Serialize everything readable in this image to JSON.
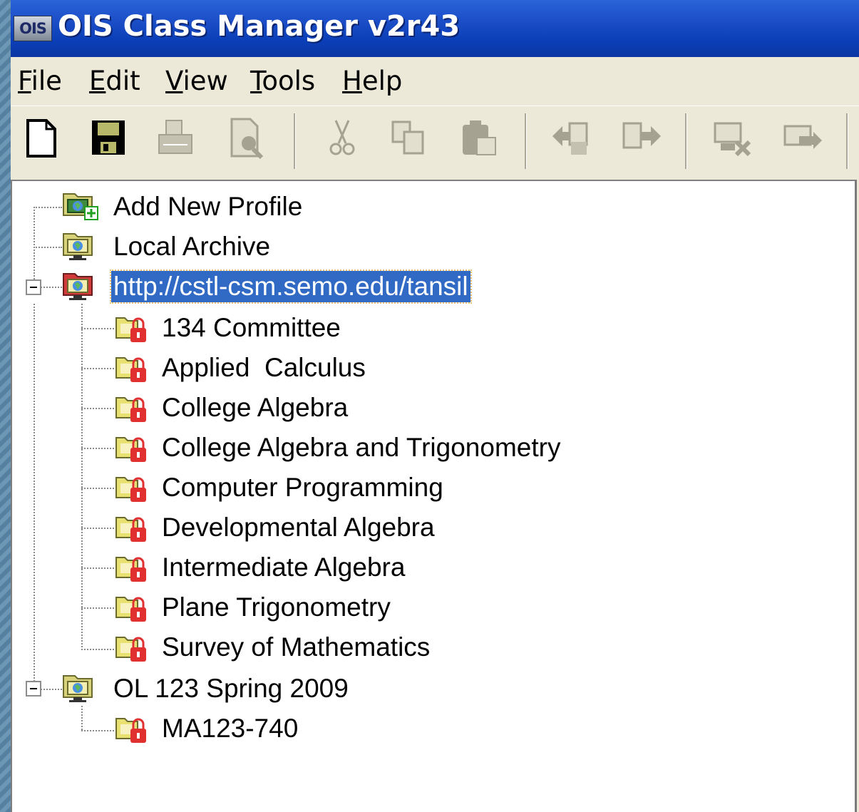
{
  "window": {
    "title": "OIS Class Manager v2r43",
    "icon_text": "OIS"
  },
  "menu": [
    {
      "label": "File",
      "underline": "F"
    },
    {
      "label": "Edit",
      "underline": "E"
    },
    {
      "label": "View",
      "underline": "V"
    },
    {
      "label": "Tools",
      "underline": "T"
    },
    {
      "label": "Help",
      "underline": "H"
    }
  ],
  "toolbar": {
    "buttons": [
      {
        "name": "new-icon",
        "enabled": true
      },
      {
        "name": "save-icon",
        "enabled": true
      },
      {
        "name": "print-icon",
        "enabled": false
      },
      {
        "name": "print-preview-icon",
        "enabled": false
      },
      {
        "name": "cut-icon",
        "enabled": false
      },
      {
        "name": "copy-icon",
        "enabled": false
      },
      {
        "name": "paste-icon",
        "enabled": false
      },
      {
        "name": "import-icon",
        "enabled": false
      },
      {
        "name": "export-icon",
        "enabled": false
      },
      {
        "name": "disconnect-icon",
        "enabled": false
      },
      {
        "name": "send-icon",
        "enabled": false
      }
    ]
  },
  "tree": {
    "add_profile": "Add New Profile",
    "local_archive": "Local Archive",
    "profile1": {
      "label": "http://cstl-csm.semo.edu/tansil",
      "selected": true,
      "expanded": true,
      "children": [
        "134 Committee",
        "Applied  Calculus",
        "College Algebra",
        "College Algebra and Trigonometry",
        "Computer Programming",
        "Developmental Algebra",
        "Intermediate Algebra",
        "Plane Trigonometry",
        "Survey of Mathematics"
      ]
    },
    "profile2": {
      "label": "OL 123 Spring 2009",
      "expanded": true,
      "children": [
        "MA123-740"
      ]
    }
  }
}
